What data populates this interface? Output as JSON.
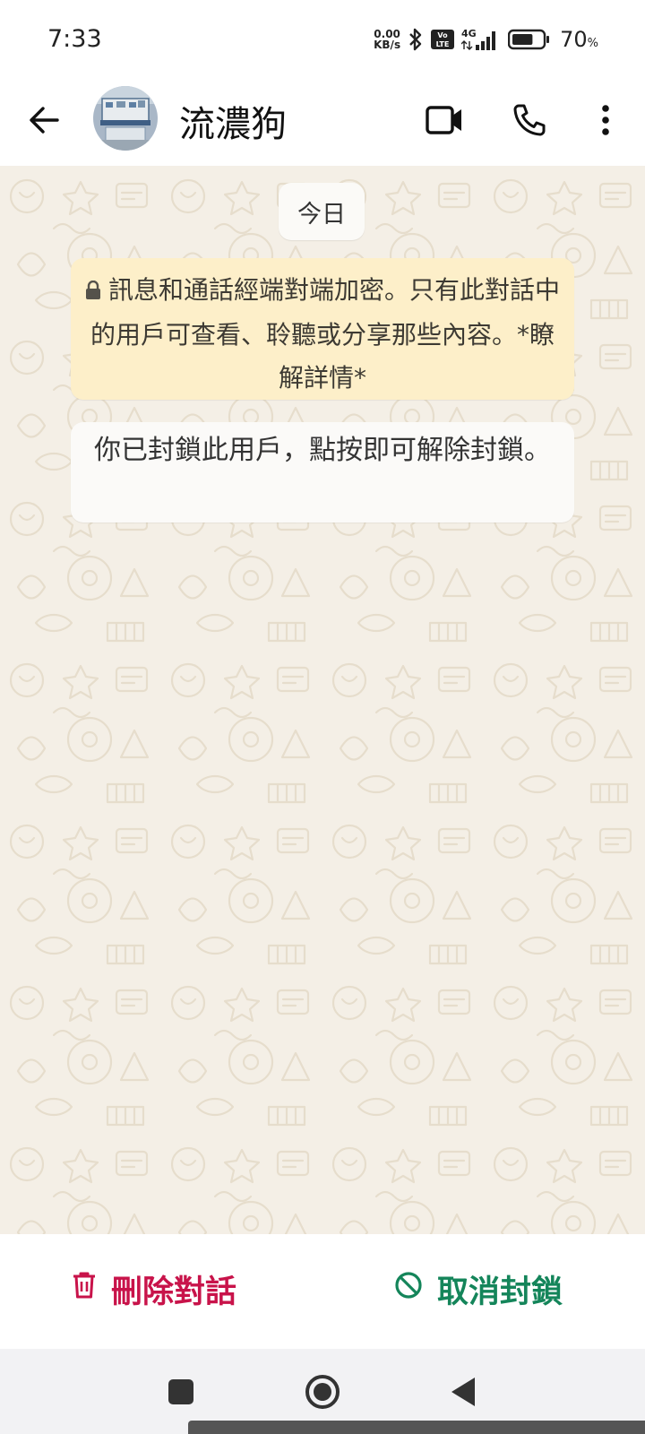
{
  "status_bar": {
    "time": "7:33",
    "net_speed_value": "0.00",
    "net_speed_unit": "KB/s",
    "volte_top": "Vo",
    "volte_bottom": "LTE",
    "network_type": "4G",
    "battery_percent": "70",
    "battery_percent_sign": "%",
    "battery_level": 0.7
  },
  "header": {
    "contact_name": "流濃狗",
    "icons": [
      "back-arrow-icon",
      "video-call-icon",
      "phone-icon",
      "more-vert-icon"
    ]
  },
  "chat": {
    "date_label": "今日",
    "encryption_notice": "訊息和通話經端對端加密。只有此對話中的用戶可查看、聆聽或分享那些內容。*瞭解詳情*",
    "blocked_notice": "你已封鎖此用戶，點按即可解除封鎖。",
    "wallpaper_color": "#f4efe6"
  },
  "actions": {
    "delete_label": "刪除對話",
    "unblock_label": "取消封鎖",
    "delete_color": "#c8134a",
    "unblock_color": "#14855a"
  },
  "nav": {
    "icons": [
      "recents-square-icon",
      "home-circle-icon",
      "back-triangle-icon"
    ]
  }
}
